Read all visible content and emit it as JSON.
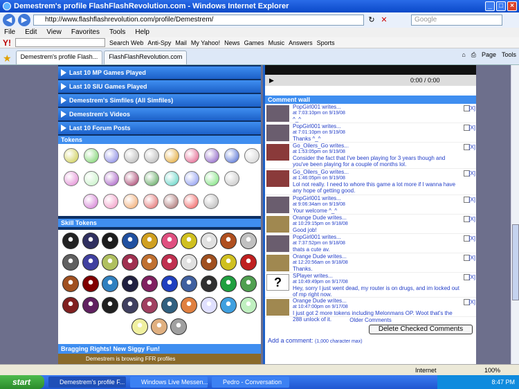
{
  "window": {
    "title": "Demestrem's profile FlashFlashRevolution.com - Windows Internet Explorer"
  },
  "address": {
    "url": "http://www.flashflashrevolution.com/profile/Demestrem/",
    "search_placeholder": "Google"
  },
  "menu": [
    "File",
    "Edit",
    "View",
    "Favorites",
    "Tools",
    "Help"
  ],
  "yahoo": {
    "logo": "Y!",
    "search_btn": "Search Web",
    "items": [
      "Anti-Spy",
      "Mail",
      "My Yahoo!",
      "News",
      "Games",
      "Music",
      "Answers",
      "Sports"
    ]
  },
  "tabs": [
    {
      "label": "Demestrem's profile Flash..."
    },
    {
      "label": "FlashFlashRevolution.com"
    }
  ],
  "toolbar_right": {
    "page": "Page",
    "tools": "Tools"
  },
  "left": {
    "sections": [
      "Last 10 MP Games Played",
      "Last 10 SIU Games Played",
      "Demestrem's Simfiles (All Simfiles)",
      "Demestrem's Videos",
      "Last 10 Forum Posts"
    ],
    "tokens_header": "Tokens",
    "skill_header": "Skill Tokens",
    "brag_header": "Bragging Rights! New Siggy Fun!",
    "brag_text": "Demestrem is browsing FFR profiles"
  },
  "video": {
    "time": "0:00 / 0:00"
  },
  "comments": {
    "header": "Comment wall",
    "items": [
      {
        "who": "PopGirl001 writes...",
        "date": "at 7:03:10pm on 9/19/08",
        "text": "^_^"
      },
      {
        "who": "PopGirl001 writes...",
        "date": "at 7:01:10pm on 9/19/08",
        "text": "Thanks ^_^"
      },
      {
        "who": "Go_Oilers_Go writes...",
        "date": "at 1:53:05pm on 9/19/08",
        "text": "Consider the fact that I've been playing for 3 years though and you've been playing for a couple of months lol."
      },
      {
        "who": "Go_Oilers_Go writes...",
        "date": "at 1:46:05pm on 9/19/08",
        "text": "Lol not really. I need to whore this game a lot more if I wanna have any hope of getting good."
      },
      {
        "who": "PopGirl001 writes...",
        "date": "at 9:06:34am on 9/19/08",
        "text": "Your welcome ^_^"
      },
      {
        "who": "Orange Dude writes...",
        "date": "at 10:29:15pm on 9/18/08",
        "text": "Good job!"
      },
      {
        "who": "PopGirl001 writes...",
        "date": "at 7:37:52pm on 9/18/08",
        "text": "thats a cute av."
      },
      {
        "who": "Orange Dude writes...",
        "date": "at 12:20:56am on 9/18/08",
        "text": "Thanks."
      },
      {
        "who": "SPlayer writes...",
        "date": "at 10:49:49pm on 9/17/08",
        "text": "Hey, sorry I just went dead, my router is on drugs, and im locked out of mp right now."
      },
      {
        "who": "Orange Dude writes...",
        "date": "at 10:47:00pm on 9/17/08",
        "text": "I just got 2 more tokens including Melonmans OP. Woot that's the 288 unlock of it."
      }
    ],
    "older": "Older Comments",
    "delete_btn": "Delete Checked Comments",
    "add": "Add a comment:",
    "add_note": "(1,000 character max)",
    "x": "[X]"
  },
  "status": {
    "zone": "Internet",
    "zoom": "100%"
  },
  "taskbar": {
    "start": "start",
    "tasks": [
      "Demestrem's profile F...",
      "Windows Live Messen...",
      "Pedro - Conversation"
    ],
    "clock": "8:47 PM"
  }
}
